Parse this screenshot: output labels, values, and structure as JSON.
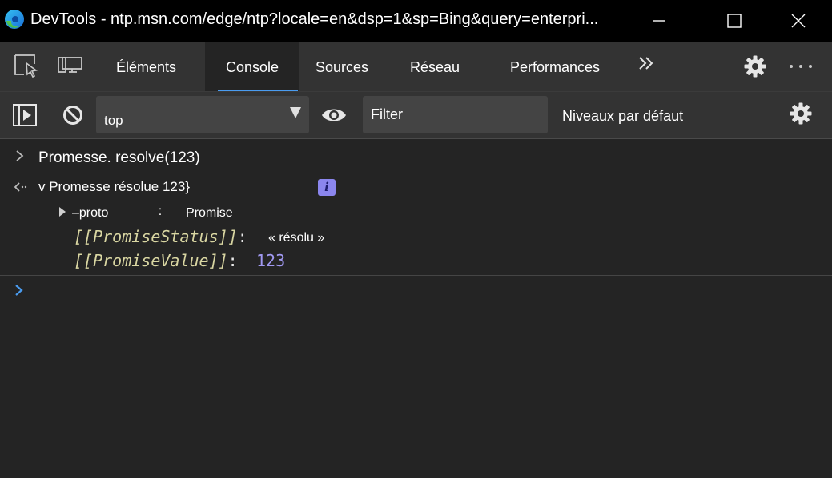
{
  "window": {
    "title": "DevTools - ntp.msn.com/edge/ntp?locale=en&dsp=1&sp=Bing&query=enterpri..."
  },
  "tabs": {
    "items": [
      {
        "label": "Éléments"
      },
      {
        "label": "Console",
        "selected": true
      },
      {
        "label": "Sources"
      },
      {
        "label": "Réseau"
      },
      {
        "label": "Performances"
      }
    ]
  },
  "toolbar": {
    "context": "top",
    "filter_placeholder": "Filter",
    "levels": "Niveaux par défaut"
  },
  "console": {
    "command": "Promesse. resolve(123)",
    "result": "v Promesse résolue 123}",
    "info_badge": "i",
    "proto_key": "–proto",
    "proto_sep": "__:",
    "proto_value": "Promise",
    "status_key": "[[PromiseStatus]]",
    "status_value": "« résolu »",
    "value_key": "[[PromiseValue]]",
    "value_value": "123"
  },
  "colors": {
    "accent": "#4a9cf0",
    "background": "#242424",
    "toolbar": "#333333",
    "property_key": "#d9d6a2",
    "number": "#a199f2"
  },
  "icons": [
    "edge-logo-icon",
    "minimize-icon",
    "maximize-icon",
    "close-icon",
    "inspect-element-icon",
    "device-toolbar-icon",
    "more-tabs-icon",
    "settings-icon",
    "more-options-icon",
    "sidebar-toggle-icon",
    "clear-console-icon",
    "eye-icon",
    "chevron-right-icon",
    "result-arrow-icon",
    "expand-triangle-icon",
    "prompt-icon"
  ]
}
